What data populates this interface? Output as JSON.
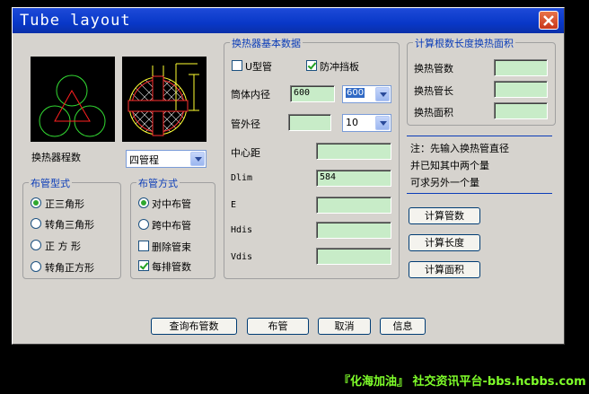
{
  "window": {
    "title": "Tube layout"
  },
  "left": {
    "procedure_label": "换热器程数",
    "procedure_value": "四管程",
    "pattern_group": {
      "title": "布管型式",
      "options": [
        "正三角形",
        "转角三角形",
        "正 方 形",
        "转角正方形"
      ],
      "selected": 0
    },
    "method_group": {
      "title": "布管方式",
      "options": [
        "对中布管",
        "跨中布管"
      ],
      "selected": 0,
      "checks": [
        {
          "label": "删除管束",
          "checked": false
        },
        {
          "label": "每排管数",
          "checked": true
        }
      ]
    }
  },
  "basic": {
    "title": "换热器基本数据",
    "u_tube": {
      "label": "U型管",
      "checked": false
    },
    "impingement": {
      "label": "防冲挡板",
      "checked": true
    },
    "shell_id": {
      "label": "筒体内径",
      "value": "600",
      "combo": "600"
    },
    "tube_od": {
      "label": "管外径",
      "value": "",
      "combo": "10"
    },
    "pitch": {
      "label": "中心距",
      "value": ""
    },
    "dlim": {
      "label": "Dlim",
      "value": "584"
    },
    "e": {
      "label": "E",
      "value": ""
    },
    "hdis": {
      "label": "Hdis",
      "value": ""
    },
    "vdis": {
      "label": "Vdis",
      "value": ""
    }
  },
  "calc": {
    "title": "计算根数长度换热面积",
    "count_label": "换热管数",
    "length_label": "换热管长",
    "area_label": "换热面积",
    "note_lines": [
      "注：先输入换热管直径",
      "并已知其中两个量",
      "可求另外一个量"
    ],
    "btn_count": "计算管数",
    "btn_length": "计算长度",
    "btn_area": "计算面积"
  },
  "bottom": {
    "query": "查询布管数",
    "layout": "布管",
    "cancel": "取消",
    "info": "信息"
  },
  "watermark": "『化海加油』 社交资讯平台-bbs.hcbbs.com",
  "colors": {
    "field_bg": "#c8ecc8",
    "group_title": "#0a3cb8",
    "titlebar": "#0838c8"
  }
}
